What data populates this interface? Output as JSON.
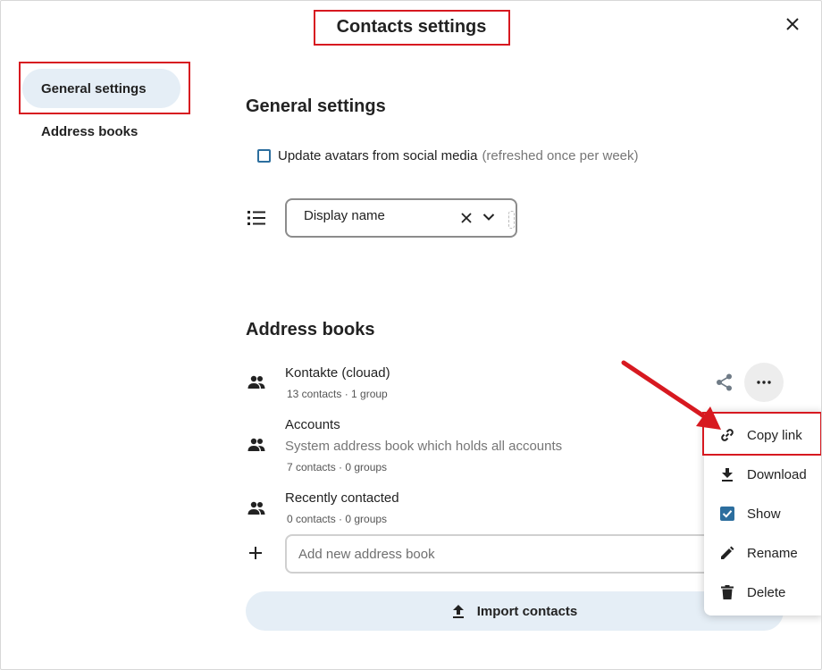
{
  "dialog": {
    "title": "Contacts settings",
    "close_icon": "close-icon"
  },
  "sidebar": {
    "items": [
      {
        "label": "General settings",
        "active": true
      },
      {
        "label": "Address books",
        "active": false
      }
    ]
  },
  "general": {
    "heading": "General settings",
    "avatar_checkbox": {
      "label": "Update avatars from social media",
      "hint": "(refreshed once per week)",
      "checked": false
    },
    "sort_select": {
      "value": "Display name",
      "icon": "list-icon"
    }
  },
  "address_books": {
    "heading": "Address books",
    "items": [
      {
        "name": "Kontakte (clouad)",
        "description": "",
        "meta": "13 contacts  · 1 group"
      },
      {
        "name": "Accounts",
        "description": "System address book which holds all accounts",
        "meta": "7 contacts  · 0 groups"
      },
      {
        "name": "Recently contacted",
        "description": "",
        "meta": "0 contacts  · 0 groups"
      }
    ],
    "add_placeholder": "Add new address book",
    "import_label": "Import contacts"
  },
  "actions_menu": {
    "items": [
      {
        "label": "Copy link",
        "icon": "link-icon"
      },
      {
        "label": "Download",
        "icon": "download-icon"
      },
      {
        "label": "Show",
        "icon": "checkbox-checked-icon",
        "checked": true
      },
      {
        "label": "Rename",
        "icon": "pencil-icon"
      },
      {
        "label": "Delete",
        "icon": "trash-icon"
      }
    ]
  },
  "colors": {
    "accent": "#2c6e9e",
    "active_bg": "#e5eef6",
    "annotation": "#d71920"
  }
}
